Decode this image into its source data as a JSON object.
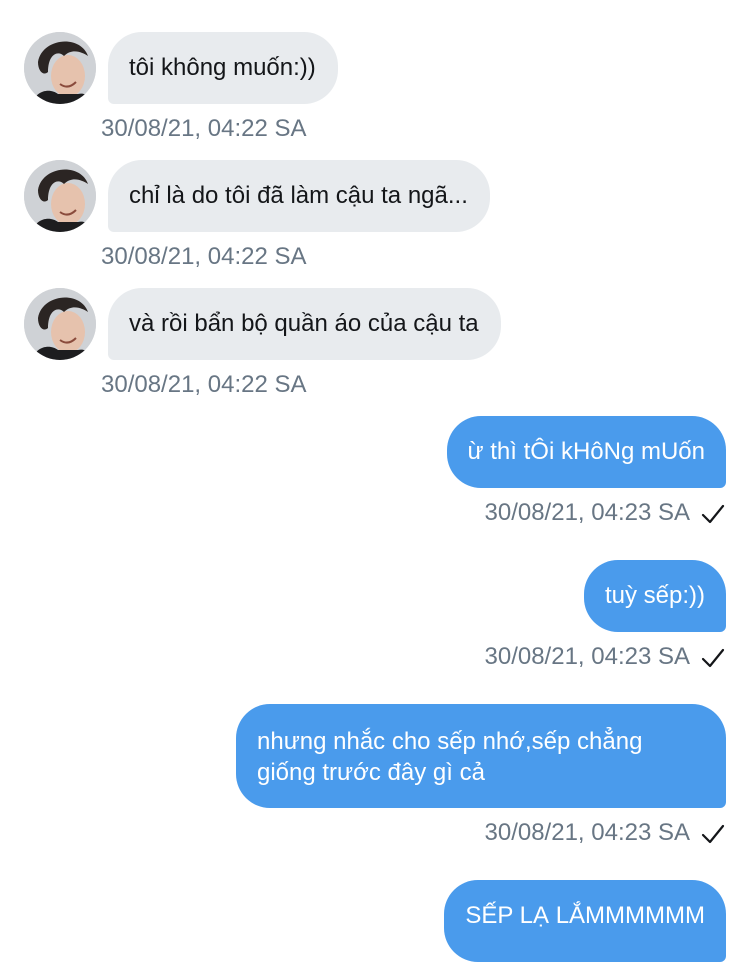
{
  "conversation": {
    "incoming": [
      {
        "text": "tôi không muốn:))",
        "time": "30/08/21, 04:22 SA"
      },
      {
        "text": "chỉ là do tôi đã làm cậu ta ngã...",
        "time": "30/08/21, 04:22 SA"
      },
      {
        "text": "và rồi bẩn bộ quần áo của cậu ta",
        "time": "30/08/21, 04:22 SA"
      }
    ],
    "outgoing": [
      {
        "text": "ừ thì tÔi kHôNg mUốn",
        "time": "30/08/21, 04:23 SA",
        "status_icon": "checkmark-icon"
      },
      {
        "text": "tuỳ sếp:))",
        "time": "30/08/21, 04:23 SA",
        "status_icon": "checkmark-icon"
      },
      {
        "text": "nhưng nhắc cho sếp nhớ,sếp chẳng giống trước đây gì cả",
        "time": "30/08/21, 04:23 SA",
        "status_icon": "checkmark-icon"
      },
      {
        "text": "SẾP LẠ LẮMMMMMM"
      }
    ]
  },
  "colors": {
    "outgoing_bubble": "#4a9bec",
    "incoming_bubble": "#e8ebee",
    "timestamp": "#687684"
  }
}
